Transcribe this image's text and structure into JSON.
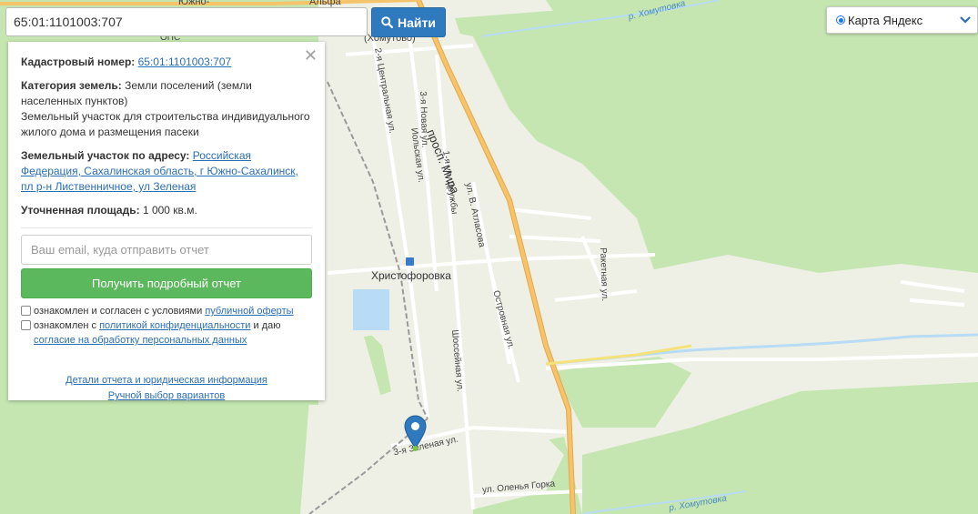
{
  "search": {
    "value": "65:01:1101003:707",
    "button_label": "Найти"
  },
  "layer_select": {
    "selected": "Карта Яндекс"
  },
  "panel": {
    "cadastral_label": "Кадастровый номер:",
    "cadastral_value": "65:01:1101003:707",
    "category_label": "Категория земель:",
    "category_value": "Земли поселений (земли населенных пунктов)",
    "purpose": "Земельный участок для строительства индивидуального жилого дома и размещения пасеки",
    "address_label": "Земельный участок по адресу:",
    "address_value": "Российская Федерация, Сахалинская область, г Южно-Сахалинск, пл р-н Лиственничное, ул Зеленая",
    "area_label": "Уточненная площадь:",
    "area_value": "1 000 кв.м.",
    "email_placeholder": "Ваш email, куда отправить отчет",
    "report_button": "Получить подробный отчет",
    "consent1_text": "ознакомлен и согласен с условиями",
    "consent1_link": "публичной оферты",
    "consent2_text": "ознакомлен с",
    "consent2_link": "политикой конфиденциальности",
    "consent2_and": "и даю",
    "consent2_link2": "согласие на обработку персональных данных",
    "details_link": "Детали отчета и юридическая информация",
    "manual_link": "Ручной выбор вариантов"
  },
  "map": {
    "labels": {
      "yuzhno": "Южно-",
      "alfa": "Альфа",
      "khomutovo": "(Хомутово)",
      "river_top": "р. Хомутовка",
      "river_bottom": "р. Хомутовка",
      "prosp_mira": "просп. Мира",
      "central": "2-я Центральная ул.",
      "novaya3": "3-я Новая ул.",
      "iolskaya": "Иольская ул.",
      "druzhby": "1-я ул. Дружбы",
      "atlasova": "ул. В. Атласова",
      "ostrovnaya": "Островная ул.",
      "raketnaya": "Ракетная ул.",
      "khristoforovka": "Христофоровка",
      "shosseynaya": "Шоссейная ул.",
      "zelenaya3": "3-я Зеленая ул.",
      "olenya": "ул. Оленья Горка",
      "ops": "ОПС"
    }
  },
  "colors": {
    "forest": "#c5e6b1",
    "town": "#eef0e6",
    "main_road": "#f5b45a",
    "water": "#b8dcf5",
    "find_button": "#2f7abf",
    "report_button": "#5cb85c",
    "marker": "#2f7abf"
  }
}
